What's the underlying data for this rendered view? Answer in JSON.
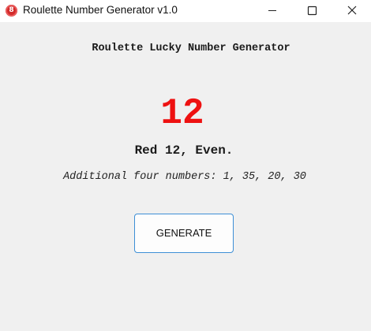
{
  "window": {
    "title": "Roulette Number Generator v1.0",
    "icon": "roulette-icon",
    "icon_glyph": "8",
    "controls": {
      "minimize": "minimize-icon",
      "maximize": "maximize-icon",
      "close": "close-icon"
    }
  },
  "main": {
    "heading": "Roulette Lucky Number Generator",
    "number": "12",
    "result": "Red 12, Even.",
    "additional": "Additional four numbers: 1, 35, 20, 30",
    "generate_label": "GENERATE"
  },
  "colors": {
    "number_color": "#ee1111",
    "button_border": "#3d8fd6",
    "background": "#f0f0f0"
  }
}
